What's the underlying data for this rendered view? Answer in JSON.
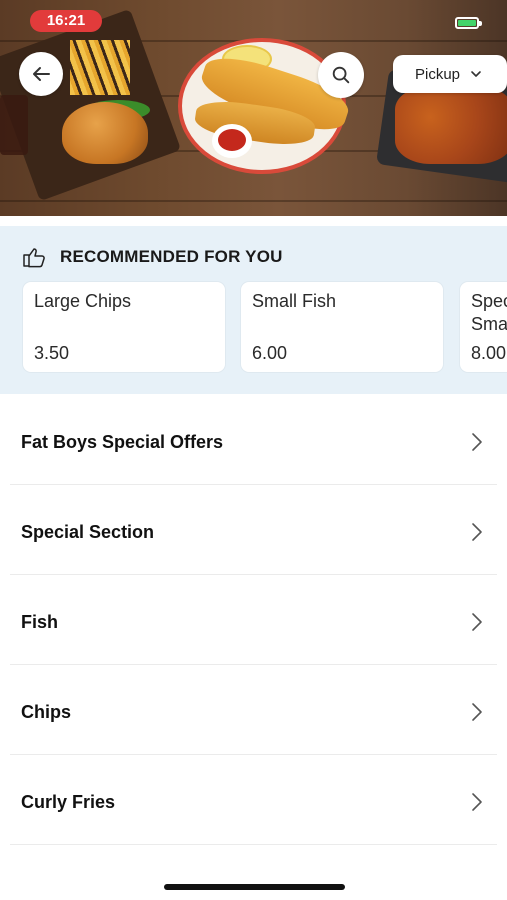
{
  "status_bar": {
    "time": "16:21"
  },
  "header": {
    "pickup_label": "Pickup"
  },
  "recommended": {
    "title": "RECOMMENDED FOR YOU",
    "items": [
      {
        "name": "Large Chips",
        "price": "3.50"
      },
      {
        "name": "Small Fish",
        "price": "6.00"
      },
      {
        "name": "Special Small",
        "price": "8.00"
      }
    ]
  },
  "menu": {
    "categories": [
      {
        "label": "Fat Boys Special Offers"
      },
      {
        "label": "Special Section"
      },
      {
        "label": "Fish"
      },
      {
        "label": "Chips"
      },
      {
        "label": "Curly Fries"
      }
    ]
  },
  "colors": {
    "accent": "#e23b3b",
    "recommended_bg": "#e7f1f8"
  }
}
